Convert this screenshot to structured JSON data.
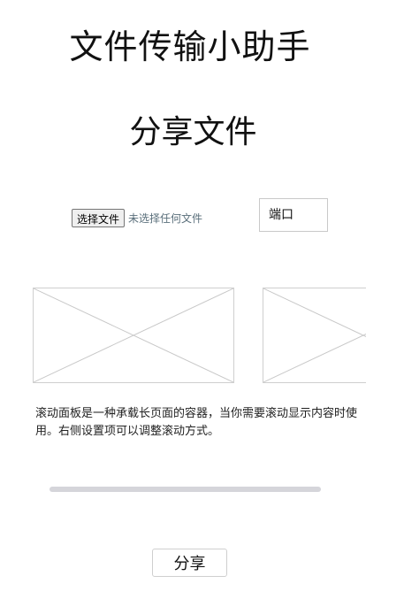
{
  "header": {
    "app_title": "文件传输小助手"
  },
  "share_section": {
    "title": "分享文件",
    "file_picker": {
      "button_label": "选择文件",
      "status": "未选择任何文件"
    },
    "port_input": {
      "placeholder": "端口",
      "value": ""
    },
    "scroll_panel": {
      "description": "滚动面板是一种承载长页面的容器，当你需要滚动显示内容时使用。右侧设置项可以调整滚动方式。"
    },
    "share_button_label": "分享"
  }
}
